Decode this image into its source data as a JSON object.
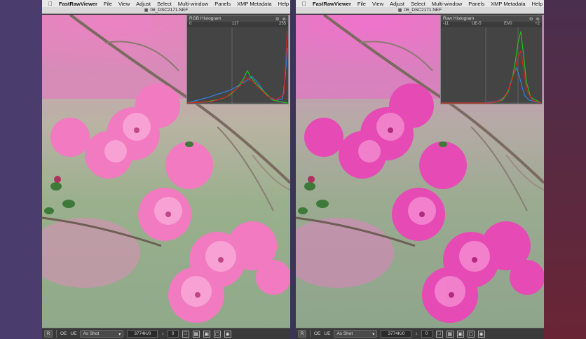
{
  "left": {
    "menubar": {
      "apple": "",
      "app": "FastRawViewer",
      "items": [
        "File",
        "View",
        "Adjust",
        "Select",
        "Multi-window",
        "Panels",
        "XMP Metadata",
        "Help"
      ]
    },
    "title": "06_DSC2171.NEF",
    "histogram": {
      "title": "RGB Histogram",
      "scale_left": "0",
      "scale_mid": "117",
      "scale_right": "255"
    },
    "statusbar": {
      "r_label": "R",
      "oe_label": "OE",
      "ue_label": "UE",
      "wb_value": "As Shot",
      "res_value": "3774K/0",
      "step": "0"
    }
  },
  "right": {
    "menubar": {
      "apple": "",
      "app": "FastRawViewer",
      "items": [
        "File",
        "View",
        "Adjust",
        "Select",
        "Multi-window",
        "Panels",
        "XMP Metadata",
        "Help"
      ]
    },
    "title": "06_DSC2171.NEF",
    "histogram": {
      "title": "Raw Histogram",
      "scale_left": "-11",
      "scale_mid": "UE-5",
      "scale_ev0": "EV0",
      "scale_right": "+2"
    },
    "statusbar": {
      "r_label": "R",
      "oe_label": "OE",
      "ue_label": "UE",
      "wb_value": "As Shot",
      "res_value": "3774K/0",
      "step": "0"
    }
  },
  "icons": {
    "gear": "gear-icon",
    "close": "close-icon",
    "dropdown": "chevron-down-icon"
  },
  "colors": {
    "hist_red": "#e02020",
    "hist_green": "#20c020",
    "hist_blue": "#3080e0",
    "magenta": "#e04aa8"
  }
}
